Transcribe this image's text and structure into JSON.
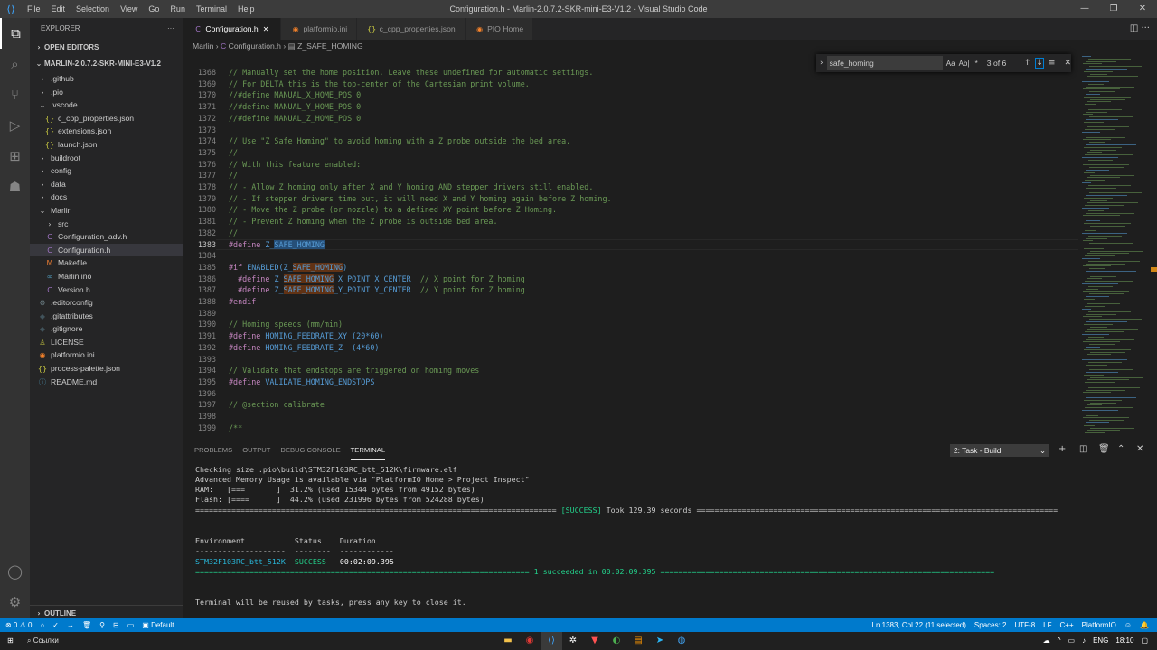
{
  "titlebar": {
    "menu": [
      "File",
      "Edit",
      "Selection",
      "View",
      "Go",
      "Run",
      "Terminal",
      "Help"
    ],
    "title": "Configuration.h - Marlin-2.0.7.2-SKR-mini-E3-V1.2 - Visual Studio Code"
  },
  "sidebar": {
    "header": "EXPLORER",
    "open_editors": "OPEN EDITORS",
    "project": "MARLIN-2.0.7.2-SKR-MINI-E3-V1.2",
    "outline": "OUTLINE",
    "items": [
      {
        "label": ".github",
        "icon": "›"
      },
      {
        "label": ".pio",
        "icon": "›"
      },
      {
        "label": ".vscode",
        "icon": "⌄"
      },
      {
        "label": "c_cpp_properties.json",
        "icon": "{}"
      },
      {
        "label": "extensions.json",
        "icon": "{}"
      },
      {
        "label": "launch.json",
        "icon": "{}"
      },
      {
        "label": "buildroot",
        "icon": "›"
      },
      {
        "label": "config",
        "icon": "›"
      },
      {
        "label": "data",
        "icon": "›"
      },
      {
        "label": "docs",
        "icon": "›"
      },
      {
        "label": "Marlin",
        "icon": "⌄"
      },
      {
        "label": "src",
        "icon": "›"
      },
      {
        "label": "Configuration_adv.h",
        "icon": "C"
      },
      {
        "label": "Configuration.h",
        "icon": "C"
      },
      {
        "label": "Makefile",
        "icon": "M"
      },
      {
        "label": "Marlin.ino",
        "icon": "∞"
      },
      {
        "label": "Version.h",
        "icon": "C"
      },
      {
        "label": ".editorconfig",
        "icon": "⚙"
      },
      {
        "label": ".gitattributes",
        "icon": "◆"
      },
      {
        "label": ".gitignore",
        "icon": "◆"
      },
      {
        "label": "LICENSE",
        "icon": "♙"
      },
      {
        "label": "platformio.ini",
        "icon": "◉"
      },
      {
        "label": "process-palette.json",
        "icon": "{}"
      },
      {
        "label": "README.md",
        "icon": "ⓘ"
      }
    ]
  },
  "tabs": [
    {
      "label": "Configuration.h",
      "icon": "C"
    },
    {
      "label": "platformio.ini",
      "icon": "◉"
    },
    {
      "label": "c_cpp_properties.json",
      "icon": "{}"
    },
    {
      "label": "PIO Home",
      "icon": "◉"
    }
  ],
  "breadcrumb": {
    "a": "Marlin",
    "b": "Configuration.h",
    "c": "Z_SAFE_HOMING"
  },
  "find": {
    "value": "safe_homing",
    "count": "3 of 6",
    "opt1": "Aa",
    "opt2": "Ab|",
    "opt3": ".*"
  },
  "editor": {
    "line_numbers": [
      "1368",
      "1369",
      "1370",
      "1371",
      "1372",
      "1373",
      "1374",
      "1375",
      "1376",
      "1377",
      "1378",
      "1379",
      "1380",
      "1381",
      "1382",
      "1383",
      "1384",
      "1385",
      "1386",
      "1387",
      "1388",
      "1389",
      "1390",
      "1391",
      "1392",
      "1393",
      "1394",
      "1395",
      "1396",
      "1397",
      "1398",
      "1399"
    ],
    "lines": [
      "// Manually set the home position. Leave these undefined for automatic settings.",
      "// For DELTA this is the top-center of the Cartesian print volume.",
      "//#define MANUAL_X_HOME_POS 0",
      "//#define MANUAL_Y_HOME_POS 0",
      "//#define MANUAL_Z_HOME_POS 0",
      "",
      "// Use \"Z Safe Homing\" to avoid homing with a Z probe outside the bed area.",
      "//",
      "// With this feature enabled:",
      "//",
      "// - Allow Z homing only after X and Y homing AND stepper drivers still enabled.",
      "// - If stepper drivers time out, it will need X and Y homing again before Z homing.",
      "// - Move the Z probe (or nozzle) to a defined XY point before Z Homing.",
      "// - Prevent Z homing when the Z probe is outside bed area.",
      "//",
      "#define Z_SAFE_HOMING",
      "",
      "#if ENABLED(Z_SAFE_HOMING)",
      "  #define Z_SAFE_HOMING_X_POINT X_CENTER  // X point for Z homing",
      "  #define Z_SAFE_HOMING_Y_POINT Y_CENTER  // Y point for Z homing",
      "#endif",
      "",
      "// Homing speeds (mm/min)",
      "#define HOMING_FEEDRATE_XY (20*60)",
      "#define HOMING_FEEDRATE_Z  (4*60)",
      "",
      "// Validate that endstops are triggered on homing moves",
      "#define VALIDATE_HOMING_ENDSTOPS",
      "",
      "// @section calibrate",
      "",
      "/**"
    ]
  },
  "panel": {
    "tabs": [
      "PROBLEMS",
      "OUTPUT",
      "DEBUG CONSOLE",
      "TERMINAL"
    ],
    "select": "2: Task - Build",
    "lines": [
      "Checking size .pio\\build\\STM32F103RC_btt_512K\\firmware.elf",
      "Advanced Memory Usage is available via \"PlatformIO Home > Project Inspect\"",
      "RAM:   [===       ]  31.2% (used 15344 bytes from 49152 bytes)",
      "Flash: [====      ]  44.2% (used 231996 bytes from 524288 bytes)"
    ],
    "success_tag": "[SUCCESS]",
    "took": " Took 129.39 seconds ",
    "table_header": "Environment           Status    Duration",
    "table_rule": "--------------------  --------  ------------",
    "env": "STM32F103RC_btt_512K",
    "status": "SUCCESS",
    "duration": "00:02:09.395",
    "summary": " 1 succeeded in 00:02:09.395 ",
    "reuse": "Terminal will be reused by tasks, press any key to close it."
  },
  "statusbar": {
    "errors": "⊗ 0 ⚠ 0",
    "default": "Default",
    "position": "Ln 1383, Col 22 (11 selected)",
    "spaces": "Spaces: 2",
    "encoding": "UTF-8",
    "eol": "LF",
    "lang": "C++",
    "platform": "PlatformIO"
  },
  "taskbar": {
    "search": "Ссылки",
    "lang": "ENG",
    "time": "18:10"
  },
  "colors": {
    "accent": "#007acc",
    "comment": "#6a9955",
    "keyword": "#c586c0",
    "macro": "#569cd6",
    "success": "#23d18b"
  }
}
